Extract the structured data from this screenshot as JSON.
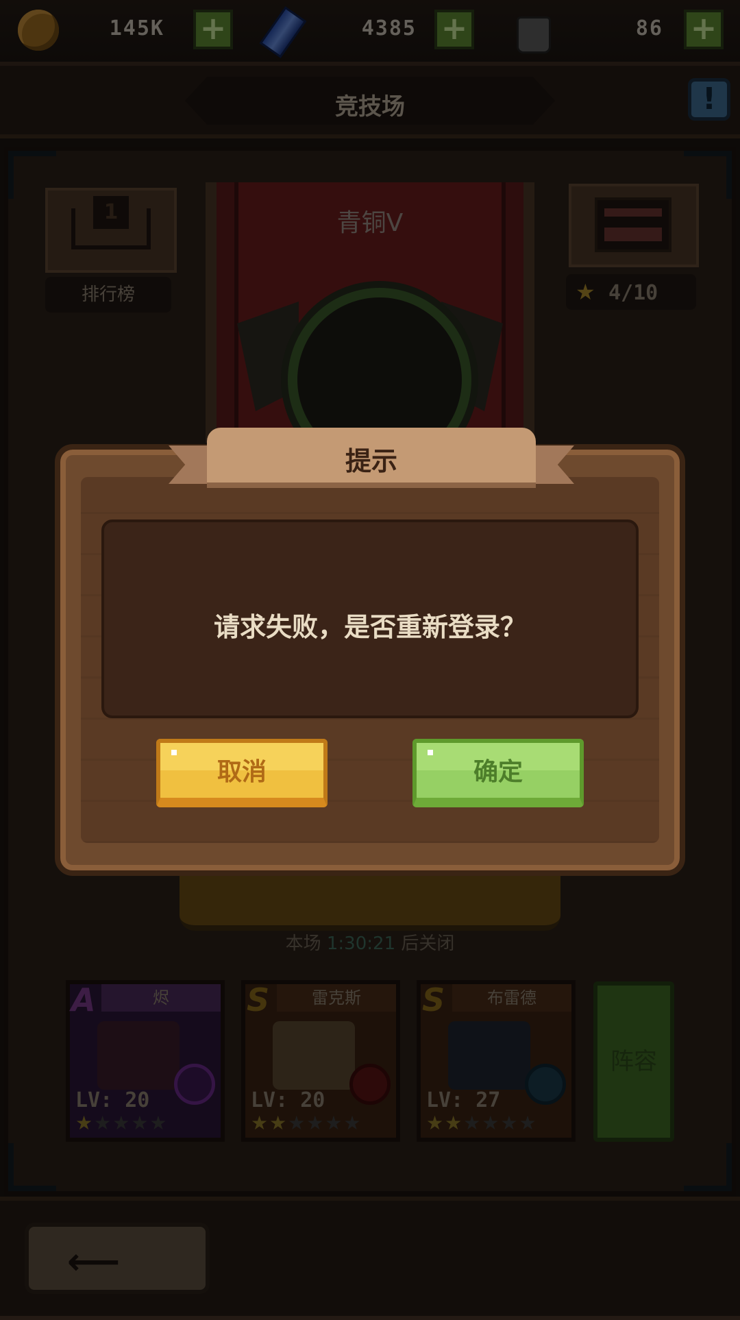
{
  "resources": {
    "gold": {
      "icon": "gold-coin-icon",
      "value": "145K"
    },
    "gems": {
      "icon": "blue-gem-icon",
      "value": "4385"
    },
    "potions": {
      "icon": "potion-bottle-icon",
      "value": "86"
    }
  },
  "header": {
    "title": "竞技场",
    "help_icon": "question-icon"
  },
  "ranking": {
    "label": "排行榜",
    "icon": "podium-icon",
    "rank": "1"
  },
  "reward": {
    "progress": "4/10",
    "icon": "treasure-chest-icon"
  },
  "arena": {
    "tier": "青铜V",
    "emblem": "bronze-tier-emblem"
  },
  "season": {
    "prefix": "本场",
    "time": "1:30:21",
    "suffix": "后关闭"
  },
  "heroes": [
    {
      "grade": "A",
      "name": "烬",
      "level": "LV: 20",
      "stars": 1,
      "max_stars": 5,
      "color": "#5a2a6a"
    },
    {
      "grade": "S",
      "name": "雷克斯",
      "level": "LV: 20",
      "stars": 2,
      "max_stars": 6,
      "color": "#6a3a18"
    },
    {
      "grade": "S",
      "name": "布雷德",
      "level": "LV: 27",
      "stars": 2,
      "max_stars": 6,
      "color": "#6a3a18"
    }
  ],
  "lineup_label": "阵容",
  "dialog": {
    "title": "提示",
    "message": "请求失败，是否重新登录？",
    "cancel": "取消",
    "confirm": "确定"
  },
  "colors": {
    "cancel": "#f0c040",
    "confirm": "#96d064",
    "accent_gold": "#a8892c"
  }
}
